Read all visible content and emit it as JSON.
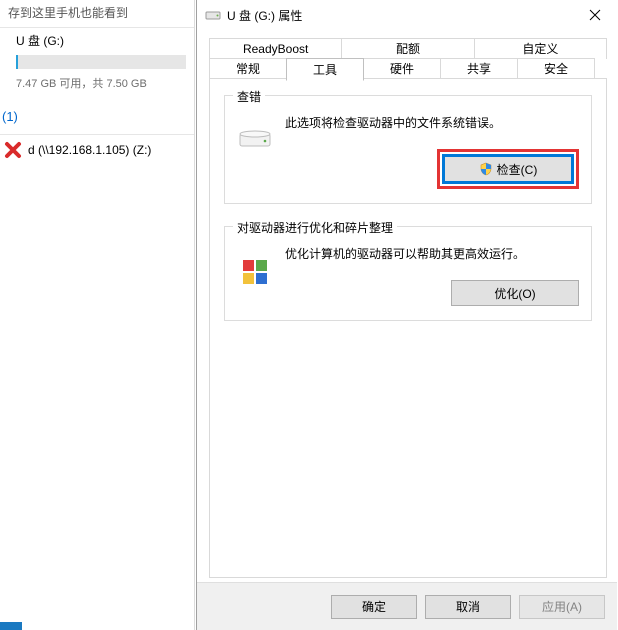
{
  "explorer": {
    "heading_partial": "存到这里手机也能看到",
    "drive_name": "U 盘 (G:)",
    "storage_text": "7.47 GB 可用，共 7.50 GB",
    "net_count": "(1)",
    "net_location": "d (\\\\192.168.1.105) (Z:)"
  },
  "dialog": {
    "title": "U 盘 (G:) 属性",
    "tabs_row1": {
      "readyboost": "ReadyBoost",
      "quota": "配额",
      "custom": "自定义"
    },
    "tabs_row2": {
      "general": "常规",
      "tools": "工具",
      "hardware": "硬件",
      "sharing": "共享",
      "security": "安全"
    },
    "group_check": {
      "legend": "查错",
      "desc": "此选项将检查驱动器中的文件系统错误。",
      "button": "检查(C)"
    },
    "group_defrag": {
      "legend": "对驱动器进行优化和碎片整理",
      "desc": "优化计算机的驱动器可以帮助其更高效运行。",
      "button": "优化(O)"
    },
    "footer": {
      "ok": "确定",
      "cancel": "取消",
      "apply": "应用(A)"
    }
  }
}
